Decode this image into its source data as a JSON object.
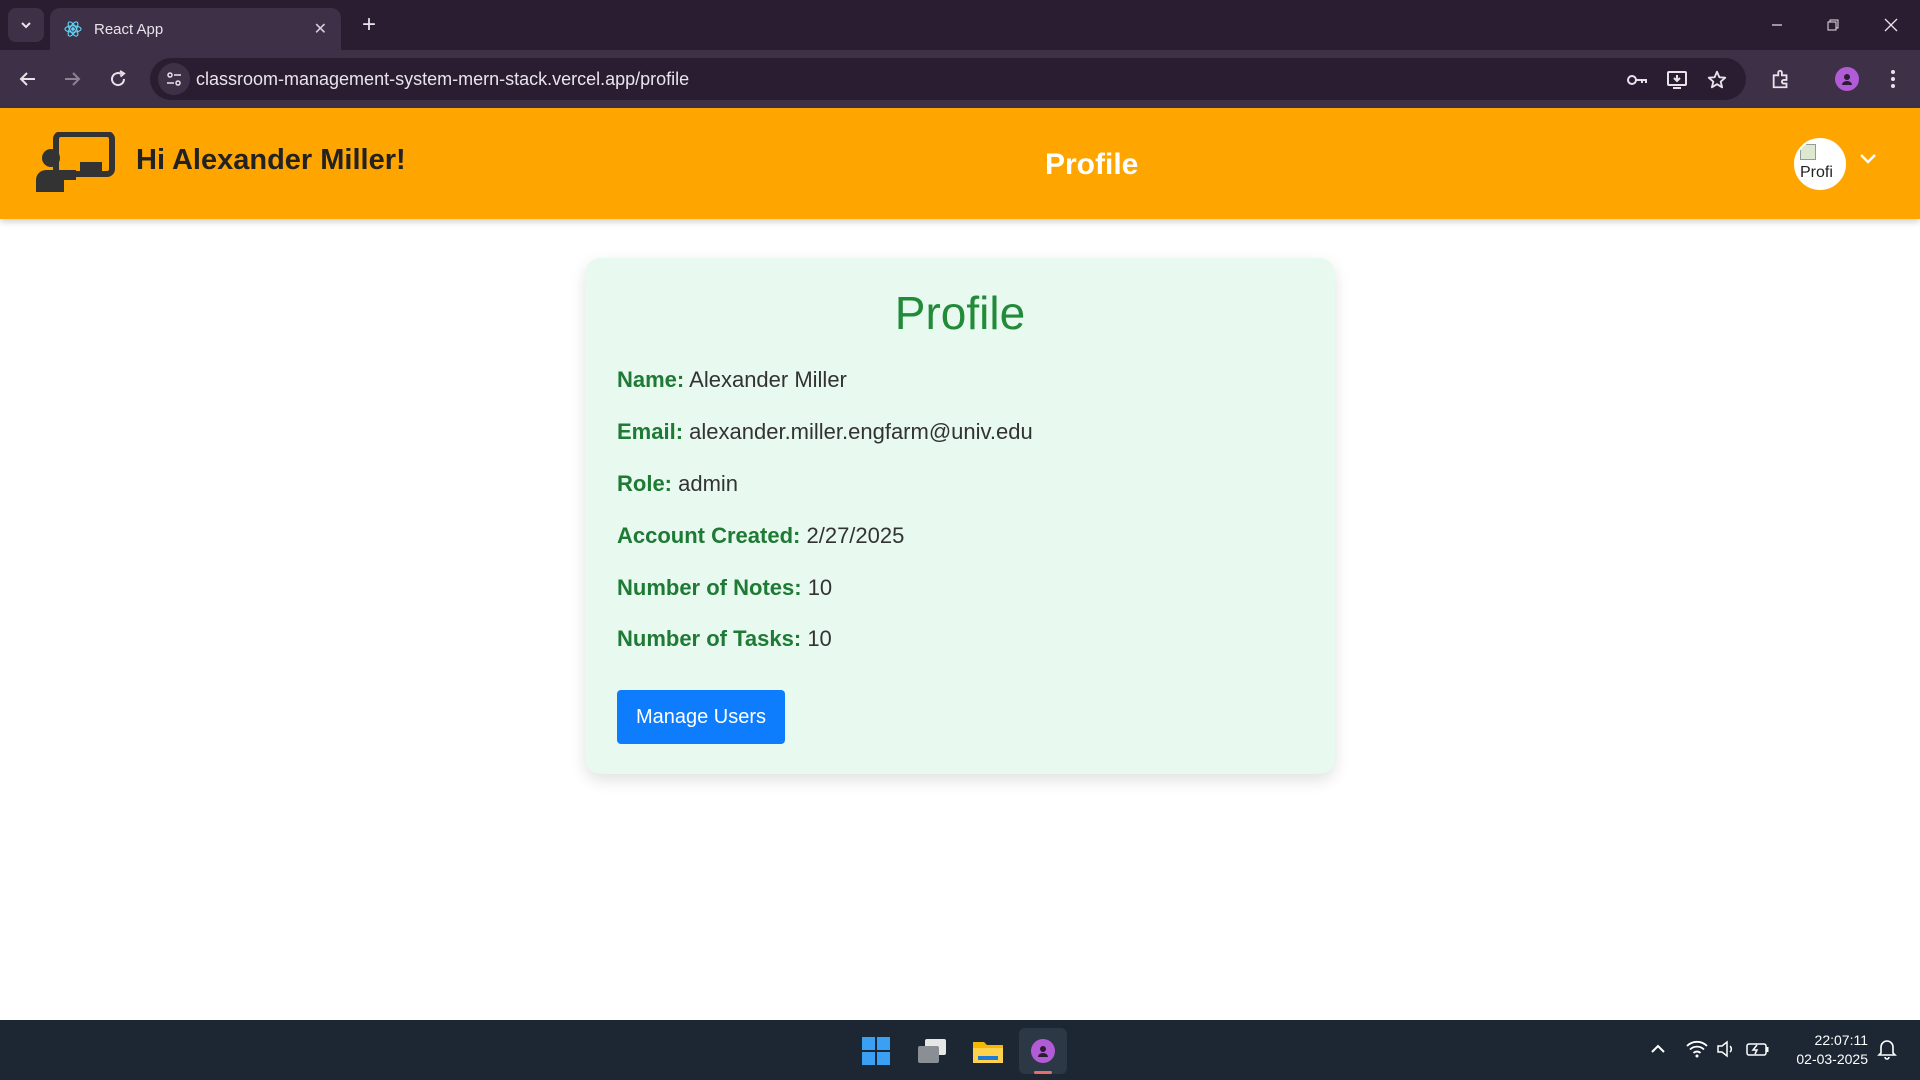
{
  "browser": {
    "tab_title": "React App",
    "url": "classroom-management-system-mern-stack.vercel.app/profile"
  },
  "header": {
    "greeting": "Hi Alexander Miller!",
    "title": "Profile",
    "avatar_alt": "Profi"
  },
  "profile": {
    "title": "Profile",
    "fields": [
      {
        "label": "Name:",
        "value": "Alexander Miller"
      },
      {
        "label": "Email:",
        "value": "alexander.miller.engfarm@univ.edu"
      },
      {
        "label": "Role:",
        "value": "admin"
      },
      {
        "label": "Account Created:",
        "value": "2/27/2025"
      },
      {
        "label": "Number of Notes:",
        "value": "10"
      },
      {
        "label": "Number of Tasks:",
        "value": "10"
      }
    ],
    "manage_button": "Manage Users"
  },
  "taskbar": {
    "time": "22:07:11",
    "date": "02-03-2025"
  },
  "colors": {
    "header_bg": "#ffa500",
    "card_bg": "#e8f9ef",
    "label_green": "#1e7a34",
    "button_blue": "#0d7dfd"
  }
}
